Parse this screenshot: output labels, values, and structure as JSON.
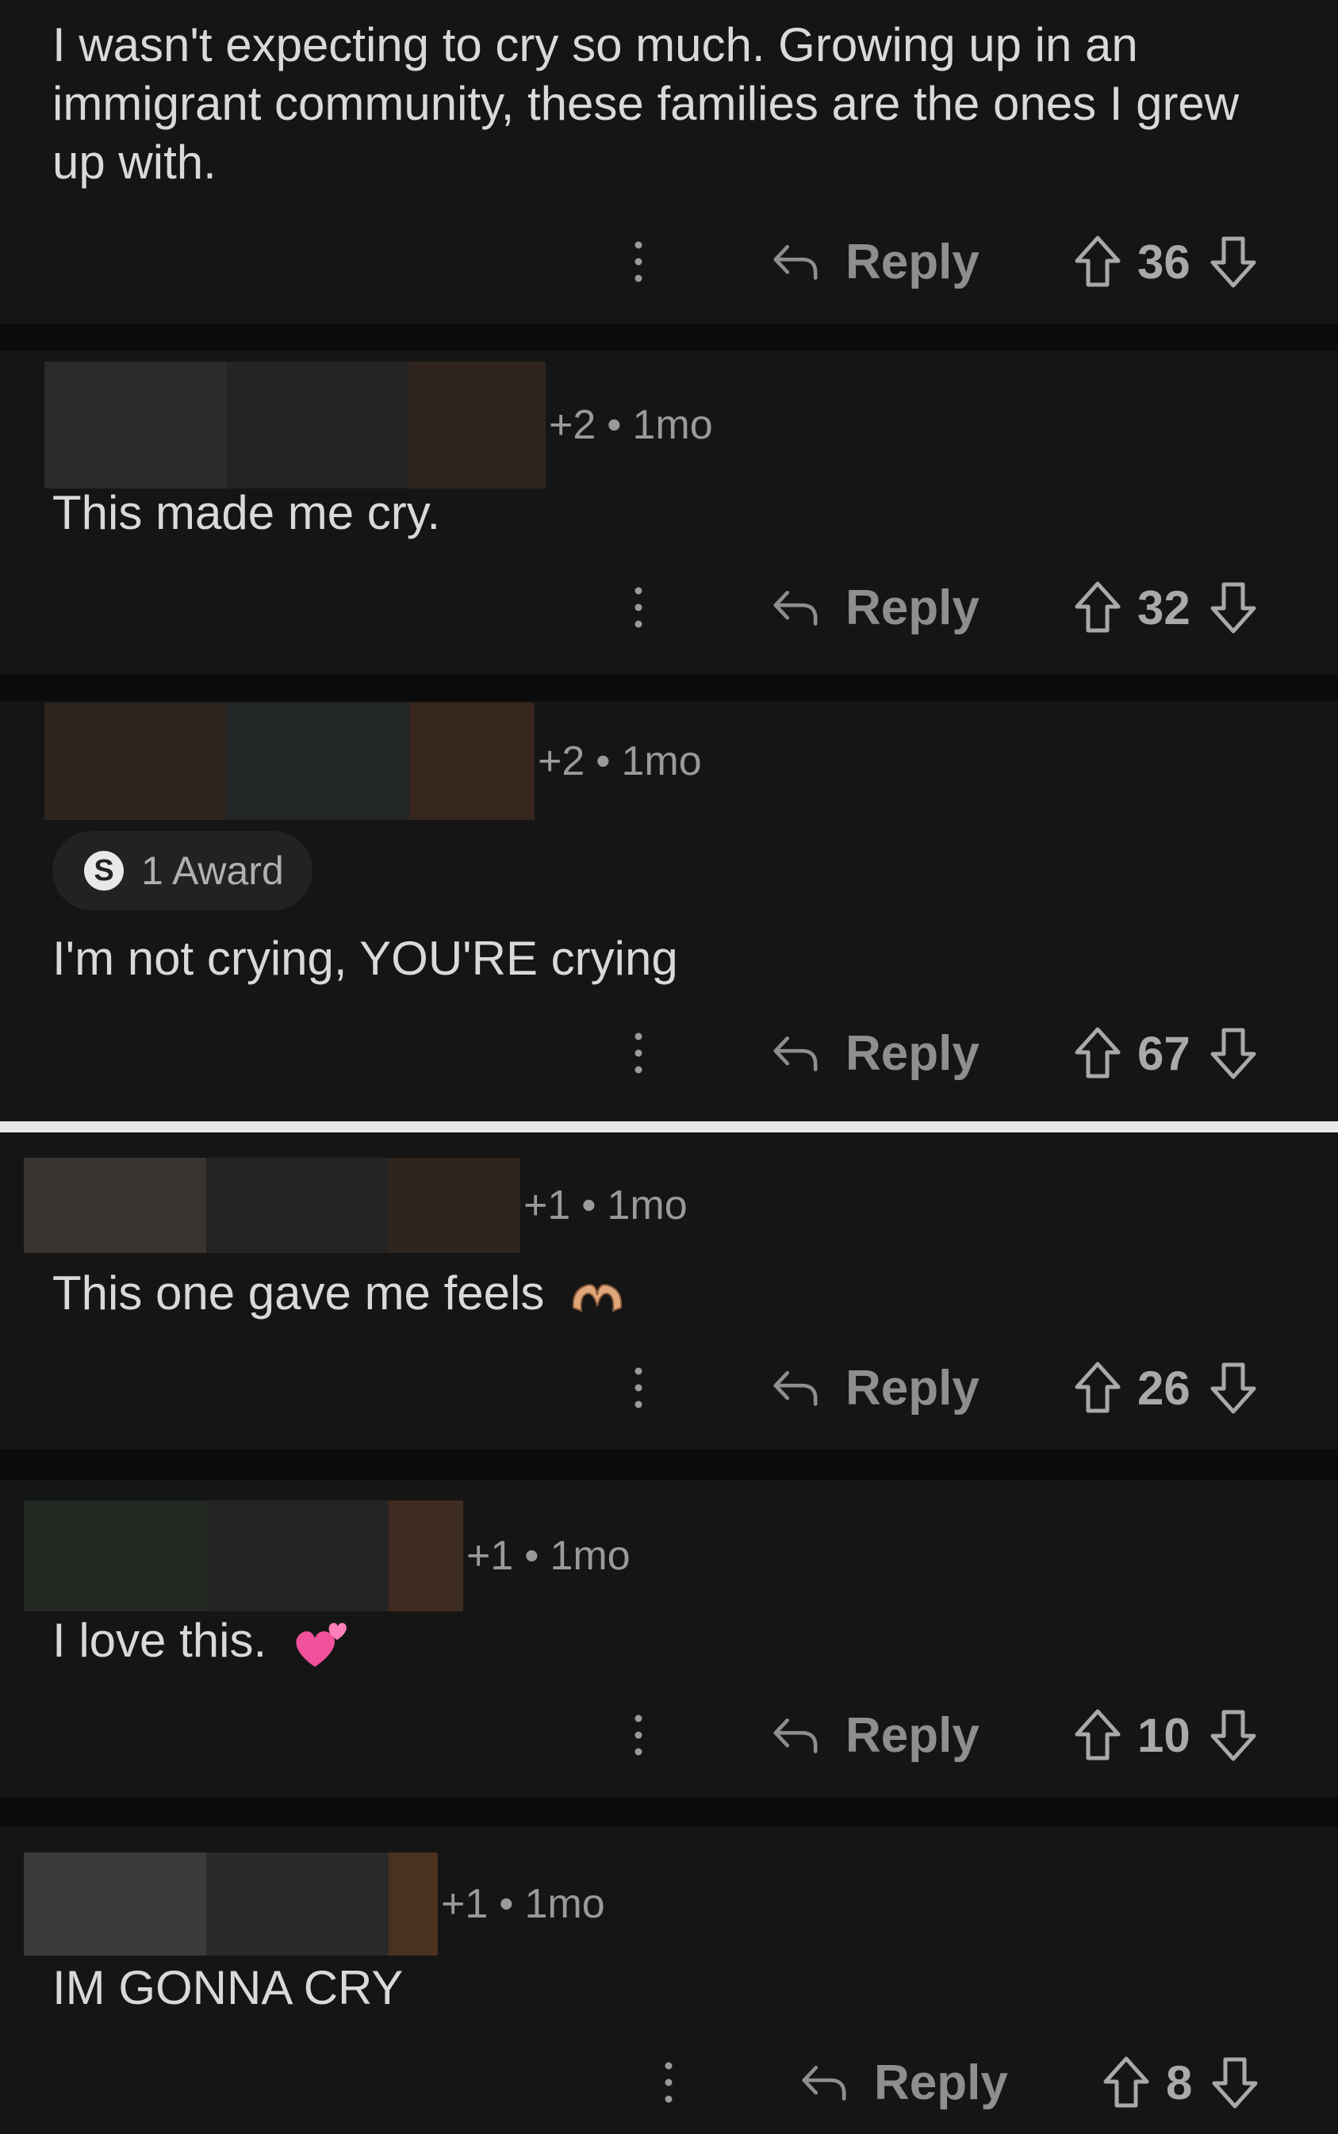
{
  "comments": [
    {
      "body": "I wasn't expecting to cry so much. Growing up in an immigrant community, these families are the ones I grew up with.",
      "reply_label": "Reply",
      "votes": "36"
    },
    {
      "karma": "+2",
      "age": "1mo",
      "body": "This made me cry.",
      "reply_label": "Reply",
      "votes": "32"
    },
    {
      "karma": "+2",
      "age": "1mo",
      "award": "1 Award",
      "body": "I'm not crying, YOU'RE crying",
      "reply_label": "Reply",
      "votes": "67"
    },
    {
      "karma": "+1",
      "age": "1mo",
      "body": "This one gave me feels",
      "emoji": "heart-hands",
      "reply_label": "Reply",
      "votes": "26"
    },
    {
      "karma": "+1",
      "age": "1mo",
      "body": "I love this.",
      "emoji": "two-hearts",
      "reply_label": "Reply",
      "votes": "10"
    },
    {
      "karma": "+1",
      "age": "1mo",
      "body": "IM GONNA CRY",
      "reply_label": "Reply",
      "votes": "8"
    }
  ],
  "icons": {
    "more": "more-vertical-icon",
    "reply": "reply-arrow-icon",
    "upvote": "upvote-arrow-icon",
    "downvote": "downvote-arrow-icon",
    "award": "silver-award-icon"
  },
  "colors": {
    "background": "#0b0b0b",
    "card": "#151515",
    "text": "#d9d9d9",
    "muted": "#9a9a9a",
    "divider": "#e9e9e9"
  }
}
